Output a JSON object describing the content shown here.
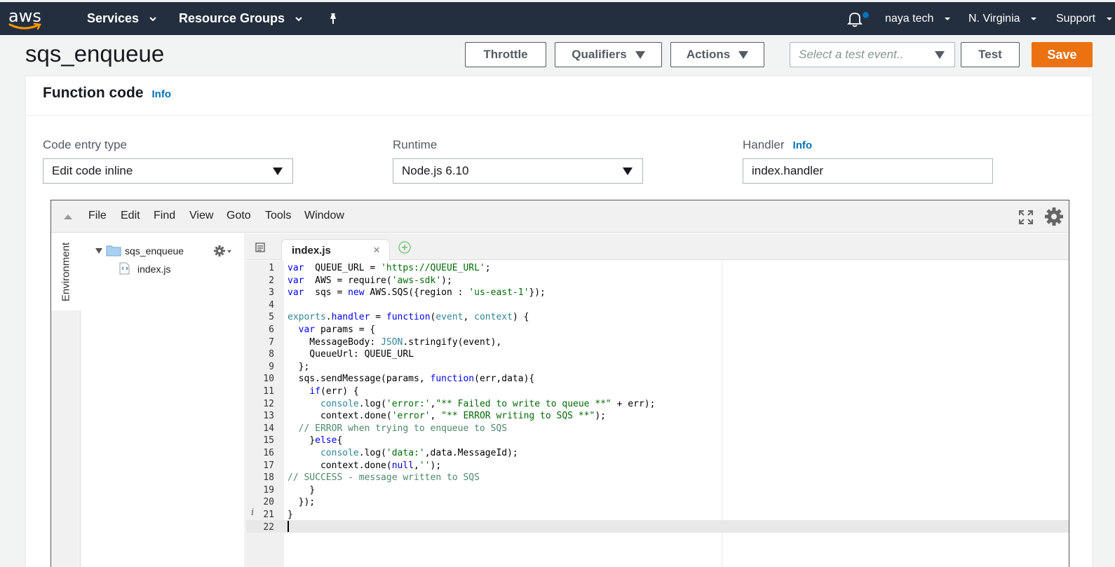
{
  "nav": {
    "logo": "aws",
    "services": "Services",
    "resource_groups": "Resource Groups",
    "account": "naya tech",
    "region": "N. Virginia",
    "support": "Support"
  },
  "header": {
    "title": "sqs_enqueue",
    "throttle": "Throttle",
    "qualifiers": "Qualifiers",
    "actions": "Actions",
    "test_event_placeholder": "Select a test event..",
    "test": "Test",
    "save": "Save"
  },
  "function_code": {
    "title": "Function code",
    "info": "Info",
    "code_entry_label": "Code entry type",
    "code_entry_value": "Edit code inline",
    "runtime_label": "Runtime",
    "runtime_value": "Node.js 6.10",
    "handler_label": "Handler",
    "handler_info": "Info",
    "handler_value": "index.handler"
  },
  "ide": {
    "menu": [
      "File",
      "Edit",
      "Find",
      "View",
      "Goto",
      "Tools",
      "Window"
    ],
    "environment_label": "Environment",
    "folder": "sqs_enqueue",
    "file": "index.js",
    "tab": "index.js",
    "tab_close": "×",
    "line_numbers": [
      "1",
      "2",
      "3",
      "4",
      "5",
      "6",
      "7",
      "8",
      "9",
      "10",
      "11",
      "12",
      "13",
      "14",
      "15",
      "16",
      "17",
      "18",
      "19",
      "20",
      "21",
      "22"
    ],
    "info_marker": "i",
    "code": [
      [
        [
          "kw",
          "var"
        ],
        [
          "",
          "  QUEUE_URL = "
        ],
        [
          "str",
          "'https://QUEUE_URL'"
        ],
        [
          "",
          ";"
        ]
      ],
      [
        [
          "kw",
          "var"
        ],
        [
          "",
          "  AWS = require("
        ],
        [
          "str",
          "'aws-sdk'"
        ],
        [
          "",
          ");"
        ]
      ],
      [
        [
          "kw",
          "var"
        ],
        [
          "",
          "  sqs = "
        ],
        [
          "kw",
          "new"
        ],
        [
          "",
          " AWS.SQS({region : "
        ],
        [
          "str",
          "'us-east-1'"
        ],
        [
          "",
          "});"
        ]
      ],
      [],
      [
        [
          "id",
          "exports"
        ],
        [
          "",
          "."
        ],
        [
          "kw",
          "handler"
        ],
        [
          "",
          " = "
        ],
        [
          "kw",
          "function"
        ],
        [
          "",
          "("
        ],
        [
          "id",
          "event"
        ],
        [
          "",
          ", "
        ],
        [
          "id",
          "context"
        ],
        [
          "",
          ") {"
        ]
      ],
      [
        [
          "",
          "  "
        ],
        [
          "kw",
          "var"
        ],
        [
          "",
          " params = {"
        ]
      ],
      [
        [
          "",
          "    MessageBody: "
        ],
        [
          "id",
          "JSON"
        ],
        [
          "",
          ".stringify(event),"
        ]
      ],
      [
        [
          "",
          "    QueueUrl: QUEUE_URL"
        ]
      ],
      [
        [
          "",
          "  };"
        ]
      ],
      [
        [
          "",
          "  sqs.sendMessage(params, "
        ],
        [
          "kw",
          "function"
        ],
        [
          "",
          "(err,data){"
        ]
      ],
      [
        [
          "",
          "    "
        ],
        [
          "kw",
          "if"
        ],
        [
          "",
          "(err) {"
        ]
      ],
      [
        [
          "",
          "      "
        ],
        [
          "id",
          "console"
        ],
        [
          "",
          ".log("
        ],
        [
          "str",
          "'error:'"
        ],
        [
          "",
          ","
        ],
        [
          "str",
          "\"** Failed to write to queue **\""
        ],
        [
          "",
          " + err);"
        ]
      ],
      [
        [
          "",
          "      context.done("
        ],
        [
          "str",
          "'error'"
        ],
        [
          "",
          ", "
        ],
        [
          "str",
          "\"** ERROR writing to SQS **\""
        ],
        [
          "",
          ");"
        ]
      ],
      [
        [
          "cmt",
          "  // ERROR when trying to enqueue to SQS"
        ]
      ],
      [
        [
          "",
          "    }"
        ],
        [
          "kw",
          "else"
        ],
        [
          "",
          "{"
        ]
      ],
      [
        [
          "",
          "      "
        ],
        [
          "id",
          "console"
        ],
        [
          "",
          ".log("
        ],
        [
          "str",
          "'data:'"
        ],
        [
          "",
          ",data.MessageId);"
        ]
      ],
      [
        [
          "",
          "      context.done("
        ],
        [
          "cn",
          "null"
        ],
        [
          "",
          ","
        ],
        [
          "str",
          "''"
        ],
        [
          "",
          ");"
        ]
      ],
      [
        [
          "cmt",
          "// SUCCESS - message written to SQS"
        ]
      ],
      [
        [
          "",
          "    }"
        ]
      ],
      [
        [
          "",
          "  });"
        ]
      ],
      [
        [
          "",
          "}"
        ]
      ],
      []
    ]
  }
}
